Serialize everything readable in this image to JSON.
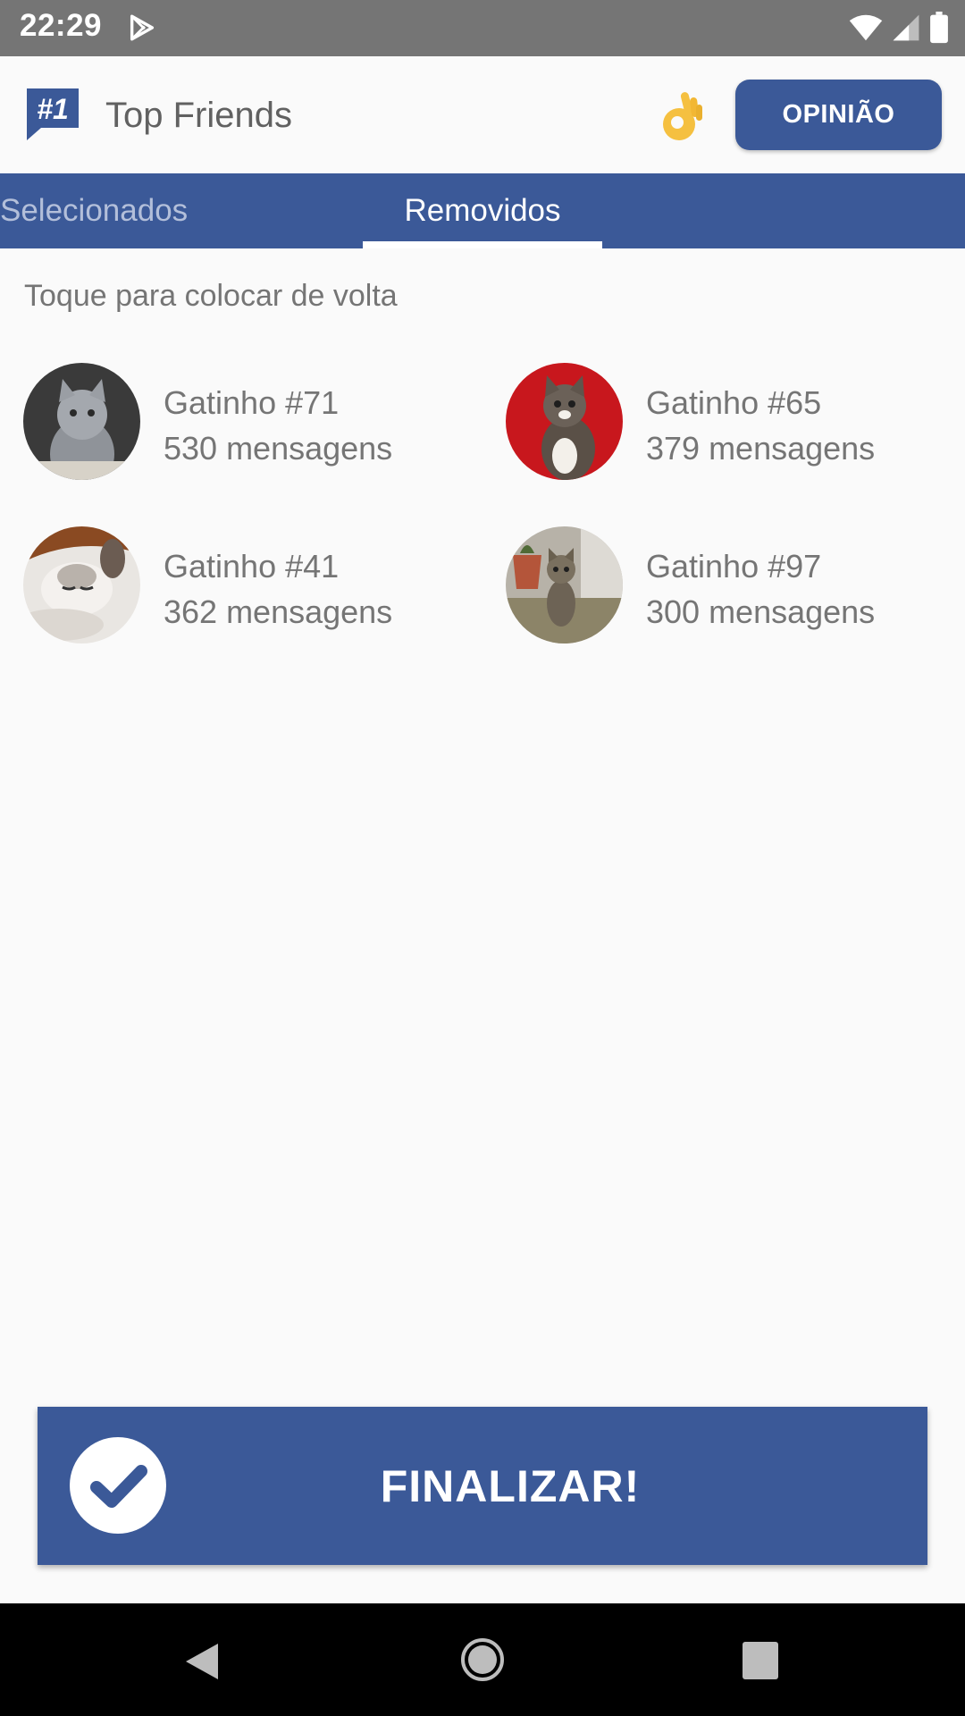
{
  "status_bar": {
    "time": "22:29",
    "icons": [
      "play-store-icon",
      "wifi-icon",
      "signal-icon",
      "battery-icon"
    ]
  },
  "app_bar": {
    "title": "Top Friends",
    "logo_text": "#1",
    "emoji": "👌",
    "feedback_button": "OPINIÃO"
  },
  "tabs": [
    {
      "label": "Selecionados",
      "active": false
    },
    {
      "label": "Removidos",
      "active": true
    }
  ],
  "hint": "Toque para colocar de volta",
  "friends": [
    {
      "name": "Gatinho #71",
      "messages": "530 mensagens",
      "avatar": "gray-kitten-photo"
    },
    {
      "name": "Gatinho #65",
      "messages": "379 mensagens",
      "avatar": "kitten-red-background-photo"
    },
    {
      "name": "Gatinho #41",
      "messages": "362 mensagens",
      "avatar": "sleepy-kitten-photo"
    },
    {
      "name": "Gatinho #97",
      "messages": "300 mensagens",
      "avatar": "tabby-kitten-photo"
    }
  ],
  "finish_button": {
    "label": "FINALIZAR!",
    "icon": "check-circle-icon"
  },
  "nav_bar": {
    "icons": [
      "back-icon",
      "home-icon",
      "recents-icon"
    ]
  },
  "colors": {
    "primary": "#3b5998",
    "status_bar": "#757575",
    "background": "#fafafa",
    "text_secondary": "#757575"
  }
}
